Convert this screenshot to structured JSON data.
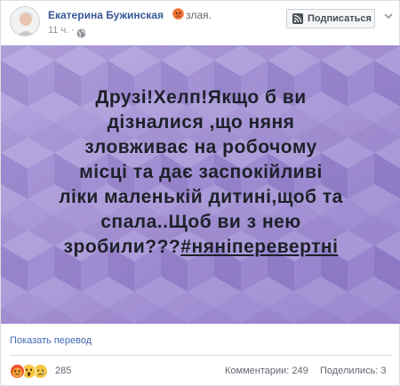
{
  "header": {
    "author_name": "Екатерина Бужинская",
    "feeling": "злая.",
    "time": "11 ч.",
    "separator": "·",
    "follow_label": "Подписаться"
  },
  "post": {
    "lines": [
      "Друзі!Хелп!Якщо б ви",
      "дізналися ,що няня",
      "зловживає на робочому",
      "місці та дає заспокійливі",
      "ліки маленькій дитині,щоб та",
      "спала..Щоб ви з нею",
      "зробили???"
    ],
    "hashtag": "#няніперевертні",
    "background_color": "#a08dd0"
  },
  "footer": {
    "translate_label": "Показать перевод",
    "reaction_count": "285",
    "comments": "Комментарии: 249",
    "shares": "Поделились: 3"
  },
  "icons": {
    "feeling": "angry-emoji-icon",
    "audience": "globe-icon",
    "follow": "rss-icon",
    "menu": "chevron-down-icon",
    "reactions": [
      "angry-reaction-icon",
      "wow-reaction-icon",
      "sad-reaction-icon"
    ]
  },
  "colors": {
    "link_blue": "#385898",
    "accent_blue": "#4267b2",
    "angry": "#f0743a",
    "wow": "#f7c745"
  }
}
